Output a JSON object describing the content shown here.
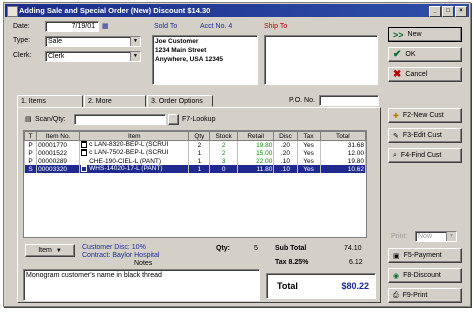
{
  "window": {
    "title": "Adding Sale and Special Order  (New)    Discount $14.30",
    "min_glyph": "_",
    "max_glyph": "□",
    "close_glyph": "×"
  },
  "header": {
    "date_label": "Date:",
    "date_value": "7/19/01",
    "type_label": "Type:",
    "type_value": "Sale",
    "clerk_label": "Clerk:",
    "clerk_value": "Clerk",
    "sold_to_label": "Sold To",
    "acct_label": "Acct No. 4",
    "ship_to_label": "Ship To",
    "sold_to_lines": [
      "Joe Customer",
      "1234 Main Street",
      "Anywhere, USA 12345"
    ]
  },
  "actions": {
    "next": "New",
    "ok": "OK",
    "cancel": "Cancel"
  },
  "tabs": [
    "1. Items",
    "2. More",
    "3. Order Options"
  ],
  "po_label": "P.O. No.",
  "scan": {
    "label": "Scan/Qty:",
    "lookup": "F7-Lookup"
  },
  "table": {
    "headers": [
      "T",
      "Item No.",
      "Item",
      "Qty",
      "Stock",
      "Retail",
      "Disc",
      "Tax",
      "Total"
    ],
    "rows": [
      {
        "t": "P",
        "item_no": "00001770",
        "item": "c LAN-8320-BEP-L (SCRUI",
        "qty": "2",
        "stock": "2",
        "retail": "19.80",
        "disc": ".20",
        "tax": "Yes",
        "total": "31.68"
      },
      {
        "t": "P",
        "item_no": "00001522",
        "item": "c LAN-7502-BEP-L (SCRUI",
        "qty": "1",
        "stock": "2",
        "retail": "15.00",
        "disc": ".20",
        "tax": "Yes",
        "total": "12.00"
      },
      {
        "t": "P",
        "item_no": "00000289",
        "item": "CHE-190-CIEL-L (PANT)",
        "qty": "1",
        "stock": "3",
        "retail": "22.00",
        "disc": ".10",
        "tax": "Yes",
        "total": "19.80"
      },
      {
        "t": "S",
        "item_no": "00003320",
        "item": "WHS-14020-17-L (PANT)",
        "qty": "1",
        "stock": "0",
        "retail": "11.80",
        "disc": ".10",
        "tax": "Yes",
        "total": "10.62"
      }
    ]
  },
  "footer": {
    "item_button": "Item",
    "customer_disc": "Customer Disc: 10%",
    "contract": "Contract: Baylor Hospital",
    "notes_label": "Notes",
    "notes_text": "Monogram customer's name in black thread",
    "qty_label": "Qty:",
    "qty_value": "5",
    "subtotal_label": "Sub Total",
    "subtotal_value": "74.10",
    "tax_label": "Tax  8.25%",
    "tax_value": "6.12",
    "total_label": "Total",
    "total_value": "$80.22"
  },
  "side_buttons": {
    "new_cust": "F2-New Cust",
    "edit_cust": "F3-Edit Cust",
    "find_cust": "F4-Find Cust",
    "print_label": "Print:",
    "print_value": "Now",
    "payment": "F5-Payment",
    "discount": "F8-Discount",
    "print": "F9-Print"
  },
  "colors": {
    "title_bar": "#1c2d8a",
    "selection": "#1e2a8e",
    "accent_red": "#c00000",
    "stock_green": "#0a8a0a"
  }
}
